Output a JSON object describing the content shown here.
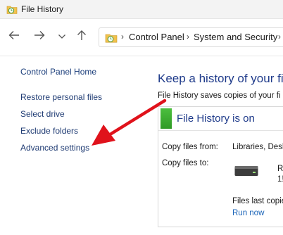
{
  "window": {
    "title": "File History"
  },
  "navigation": {
    "back_icon": "arrow-left-icon",
    "forward_icon": "arrow-right-icon",
    "recent_icon": "chevron-down-icon",
    "up_icon": "arrow-up-icon"
  },
  "address_bar": {
    "crumbs": [
      "Control Panel",
      "System and Security"
    ]
  },
  "left_nav": {
    "items": [
      "Control Panel Home",
      "Restore personal files",
      "Select drive",
      "Exclude folders",
      "Advanced settings"
    ]
  },
  "main": {
    "heading": "Keep a history of your file",
    "description": "File History saves copies of your fi",
    "status_title": "File History is on",
    "copy_from_label": "Copy files from:",
    "copy_from_value": "Libraries, Desk",
    "copy_to_label": "Copy files to:",
    "drive_text_1": "R",
    "drive_text_2": "1!",
    "files_last_copied": "Files last copie",
    "run_now": "Run now"
  },
  "colors": {
    "link": "#1f3b73",
    "heading": "#1e3a8a",
    "status_green": "#3aab2e",
    "annotation_arrow": "#e0121b"
  }
}
